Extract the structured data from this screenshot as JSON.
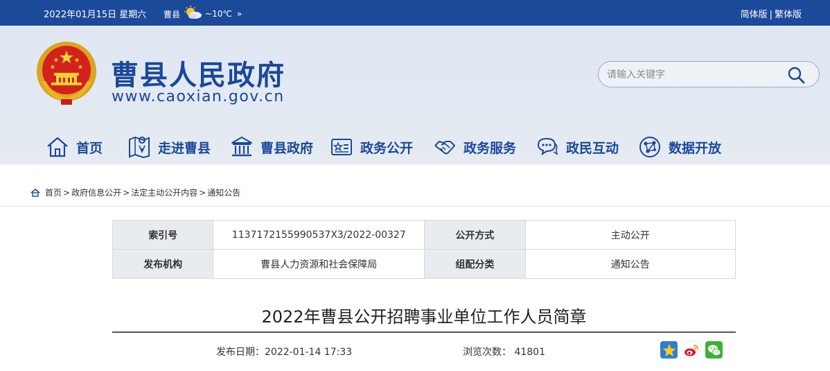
{
  "topbar": {
    "date": "2022年01月15日 星期六",
    "weather_city": "曹县",
    "weather_temp": "~10℃",
    "weather_more": "»",
    "lang_simplified": "简体版",
    "lang_separator": "|",
    "lang_traditional": "繁体版"
  },
  "header": {
    "title": "曹县人民政府",
    "url": "www.caoxian.gov.cn",
    "search_placeholder": "请输入关键字"
  },
  "nav": [
    {
      "label": "首页",
      "icon": "home-icon"
    },
    {
      "label": "走进曹县",
      "icon": "map-icon"
    },
    {
      "label": "曹县政府",
      "icon": "government-building-icon"
    },
    {
      "label": "政务公开",
      "icon": "notice-board-icon"
    },
    {
      "label": "政务服务",
      "icon": "handshake-icon"
    },
    {
      "label": "政民互动",
      "icon": "chat-bubbles-icon"
    },
    {
      "label": "数据开放",
      "icon": "data-network-icon"
    }
  ],
  "breadcrumb": {
    "items": [
      "首页",
      "政府信息公开",
      "法定主动公开内容",
      "通知公告"
    ],
    "separator": ">"
  },
  "info": {
    "rows": [
      {
        "k1": "索引号",
        "v1": "11371721559905​37X3/2022-00327",
        "k2": "公开方式",
        "v2": "主动公开"
      },
      {
        "k1": "发布机构",
        "v1": "曹县人力资源和社会保障局",
        "k2": "组配分类",
        "v2": "通知公告"
      }
    ]
  },
  "article": {
    "title": "2022年曹县公开招聘事业单位工作人员简章",
    "publish_label": "发布日期：",
    "publish_date": "2022-01-14 17:33",
    "views_label": "浏览次数：",
    "views_count": "41801"
  },
  "share": [
    "qzone-icon",
    "weibo-icon",
    "wechat-icon"
  ],
  "colors": {
    "topbar": "#1c4a9a",
    "brand_blue": "#1a4899",
    "header_bg": "#e2e8f2",
    "label_cell_bg": "#e8ecf1"
  }
}
